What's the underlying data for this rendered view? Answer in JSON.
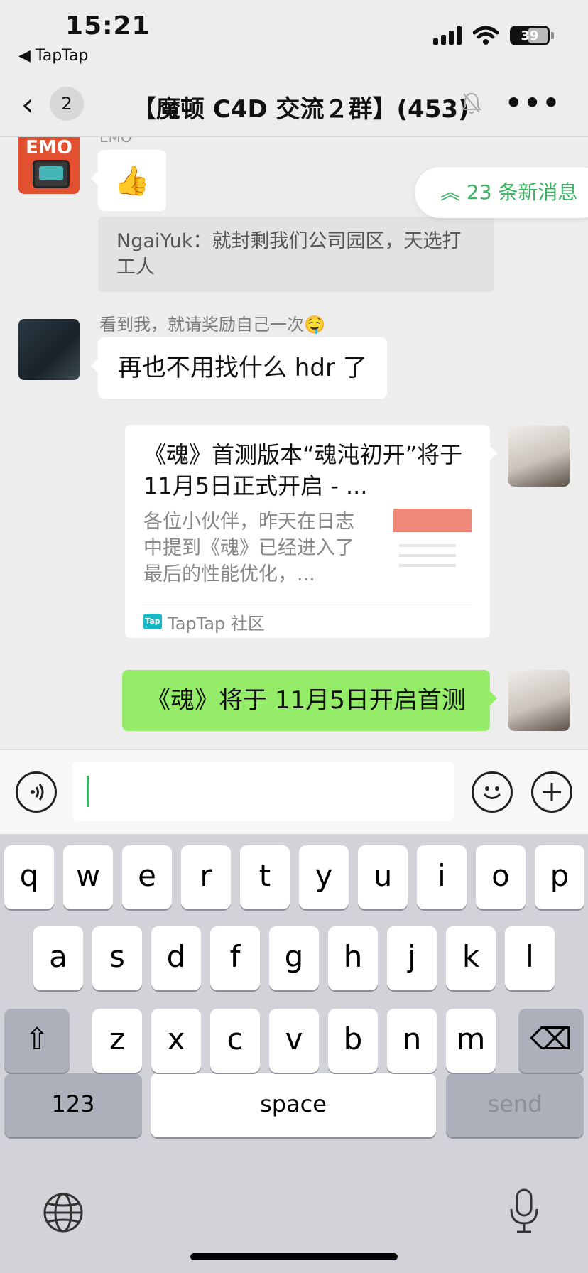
{
  "status_bar": {
    "time": "15:21",
    "back_app": "◀ TapTap",
    "battery": "39"
  },
  "nav": {
    "back_count": "2",
    "title": "【魔顿 C4D 交流２群】(453)",
    "more": "•••"
  },
  "chat": {
    "partial_sender": "EMO",
    "emo_avatar_text": "EMO",
    "thumb_emoji": "👍",
    "quote": "NgaiYuk：就封剩我们公司园区，天选打工人",
    "sender_name": "看到我，就请奖励自己一次🤤",
    "msg_hdr": "再也不用找什么 hdr 了",
    "link_card": {
      "title": "《魂》首测版本“魂沌初开”将于 11月5日正式开启 - ...",
      "desc": "各位小伙伴，昨天在日志中提到《魂》已经进入了最后的性能优化，...",
      "source_logo": "Tap",
      "source": "TapTap 社区"
    },
    "msg_green": "《魂》将于 11月5日开启首测",
    "new_messages": "︽ 23 条新消息"
  },
  "input": {
    "value": ""
  },
  "keyboard": {
    "row1": [
      "q",
      "w",
      "e",
      "r",
      "t",
      "y",
      "u",
      "i",
      "o",
      "p"
    ],
    "row2": [
      "a",
      "s",
      "d",
      "f",
      "g",
      "h",
      "j",
      "k",
      "l"
    ],
    "row3": [
      "z",
      "x",
      "c",
      "v",
      "b",
      "n",
      "m"
    ],
    "shift": "⇧",
    "delete": "⌫",
    "num": "123",
    "space": "space",
    "send": "send"
  }
}
